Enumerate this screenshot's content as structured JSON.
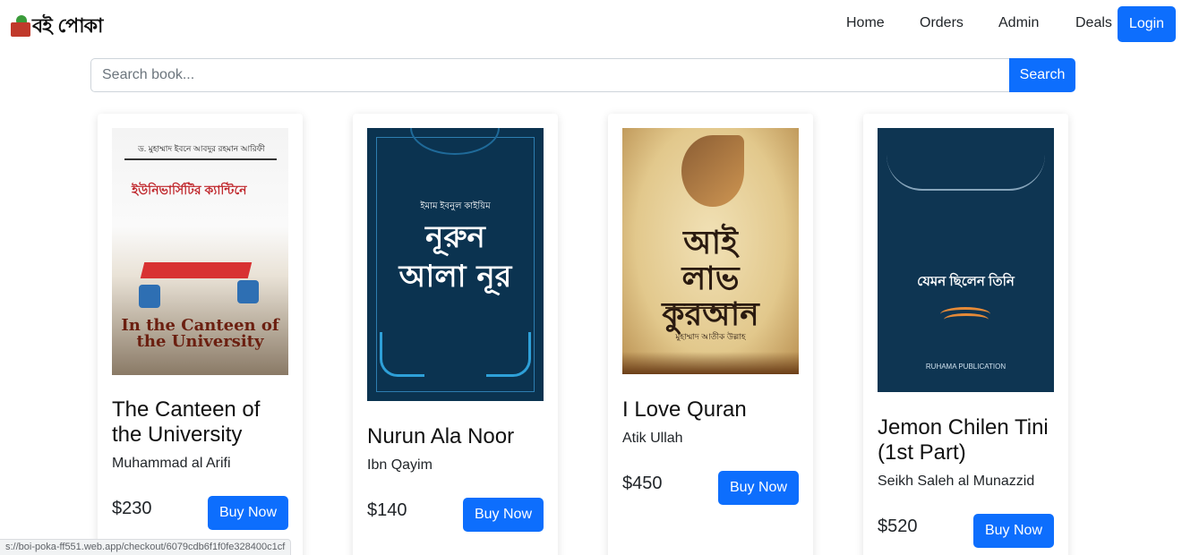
{
  "brand": {
    "logo_text": "বই পোকা"
  },
  "nav": {
    "links": [
      "Home",
      "Orders",
      "Admin",
      "Deals"
    ],
    "login_label": "Login"
  },
  "search": {
    "placeholder": "Search book...",
    "value": "",
    "button_label": "Search"
  },
  "books": [
    {
      "title": "The Canteen of the University",
      "author": "Muhammad al Arifi",
      "price": "$230",
      "buy_label": "Buy Now"
    },
    {
      "title": "Nurun Ala Noor",
      "author": "Ibn Qayim",
      "price": "$140",
      "buy_label": "Buy Now"
    },
    {
      "title": "I Love Quran",
      "author": "Atik Ullah",
      "price": "$450",
      "buy_label": "Buy Now"
    },
    {
      "title": "Jemon Chilen Tini (1st Part)",
      "author": "Seikh Saleh al Munazzid",
      "price": "$520",
      "buy_label": "Buy Now"
    }
  ],
  "covers": [
    {
      "top_text": "ড. মুহাম্মাদ ইবনে আবদুর রহমান আরিফী",
      "title_text": "ইউনিভার্সিটির ক্যান্টিনে",
      "english_text": "In the Canteen of the University"
    },
    {
      "sub_text": "ইমাম ইবনুল কাইয়িম",
      "title_text": "নূরুন আলা নূর"
    },
    {
      "title_text": "আই লাভ কুরআন",
      "author_text": "মুহাম্মাদ আতীক উল্লাহ"
    },
    {
      "title_text": "যেমন ছিলেন তিনি",
      "publisher_text": "RUHAMA PUBLICATION"
    }
  ],
  "status_bar": {
    "url": "s://boi-poka-ff551.web.app/checkout/6079cdb6f1f0fe328400c1cf"
  },
  "colors": {
    "primary": "#0d6efd",
    "text": "#212529",
    "card_bg": "#ffffff"
  }
}
